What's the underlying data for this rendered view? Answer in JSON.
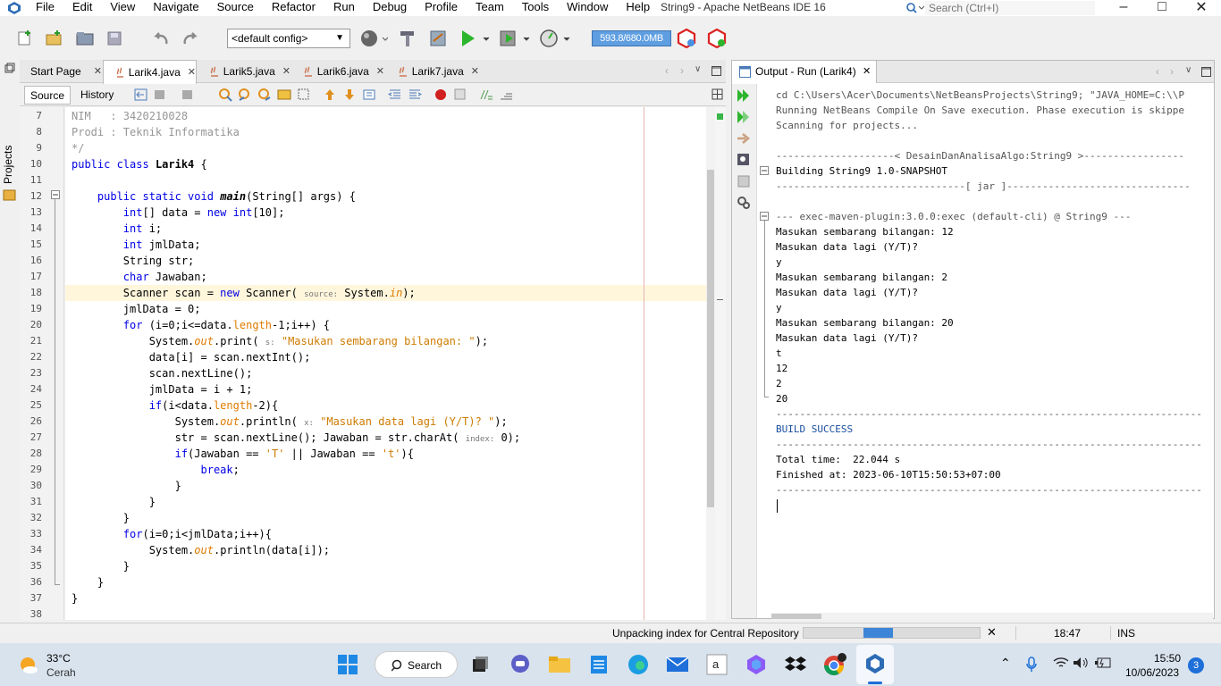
{
  "window": {
    "title": "String9 - Apache NetBeans IDE 16",
    "search_placeholder": "Search (Ctrl+I)"
  },
  "menubar": [
    "File",
    "Edit",
    "View",
    "Navigate",
    "Source",
    "Refactor",
    "Run",
    "Debug",
    "Profile",
    "Team",
    "Tools",
    "Window",
    "Help"
  ],
  "toolbar": {
    "config": "<default config>",
    "memory": "593.8/680.0MB"
  },
  "sidebar": {
    "projects_label": "Projects"
  },
  "editor": {
    "tabs": [
      "Start Page",
      "Larik4.java",
      "Larik5.java",
      "Larik6.java",
      "Larik7.java"
    ],
    "active_tab": "Larik4.java",
    "source_label": "Source",
    "history_label": "History",
    "line_numbers": [
      "7",
      "8",
      "9",
      "10",
      "11",
      "12",
      "13",
      "14",
      "15",
      "16",
      "17",
      "18",
      "19",
      "20",
      "21",
      "22",
      "23",
      "24",
      "25",
      "26",
      "27",
      "28",
      "29",
      "30",
      "31",
      "32",
      "33",
      "34",
      "35",
      "36",
      "37",
      "38"
    ]
  },
  "output": {
    "tab_label": "Output - Run (Larik4)",
    "lines": [
      "cd C:\\Users\\Acer\\Documents\\NetBeansProjects\\String9; \"JAVA_HOME=C:\\\\P",
      "Running NetBeans Compile On Save execution. Phase execution is skippe",
      "Scanning for projects...",
      "",
      "--------------------< DesainDanAnalisaAlgo:String9 >-----------------",
      "Building String9 1.0-SNAPSHOT",
      "--------------------------------[ jar ]-------------------------------",
      "",
      "--- exec-maven-plugin:3.0.0:exec (default-cli) @ String9 ---",
      "Masukan sembarang bilangan: 12",
      "Masukan data lagi (Y/T)?",
      "y",
      "Masukan sembarang bilangan: 2",
      "Masukan data lagi (Y/T)?",
      "y",
      "Masukan sembarang bilangan: 20",
      "Masukan data lagi (Y/T)?",
      "t",
      "12",
      "2",
      "20",
      "------------------------------------------------------------------------",
      "BUILD SUCCESS",
      "------------------------------------------------------------------------",
      "Total time:  22.044 s",
      "Finished at: 2023-06-10T15:50:53+07:00",
      "------------------------------------------------------------------------"
    ]
  },
  "statusbar": {
    "message": "Unpacking index for Central Repository",
    "progress": 0.35,
    "position": "18:47",
    "mode": "INS"
  },
  "taskbar": {
    "temperature": "33°C",
    "weather": "Cerah",
    "search_label": "Search",
    "time": "15:50",
    "date": "10/06/2023",
    "notification_count": "3"
  }
}
